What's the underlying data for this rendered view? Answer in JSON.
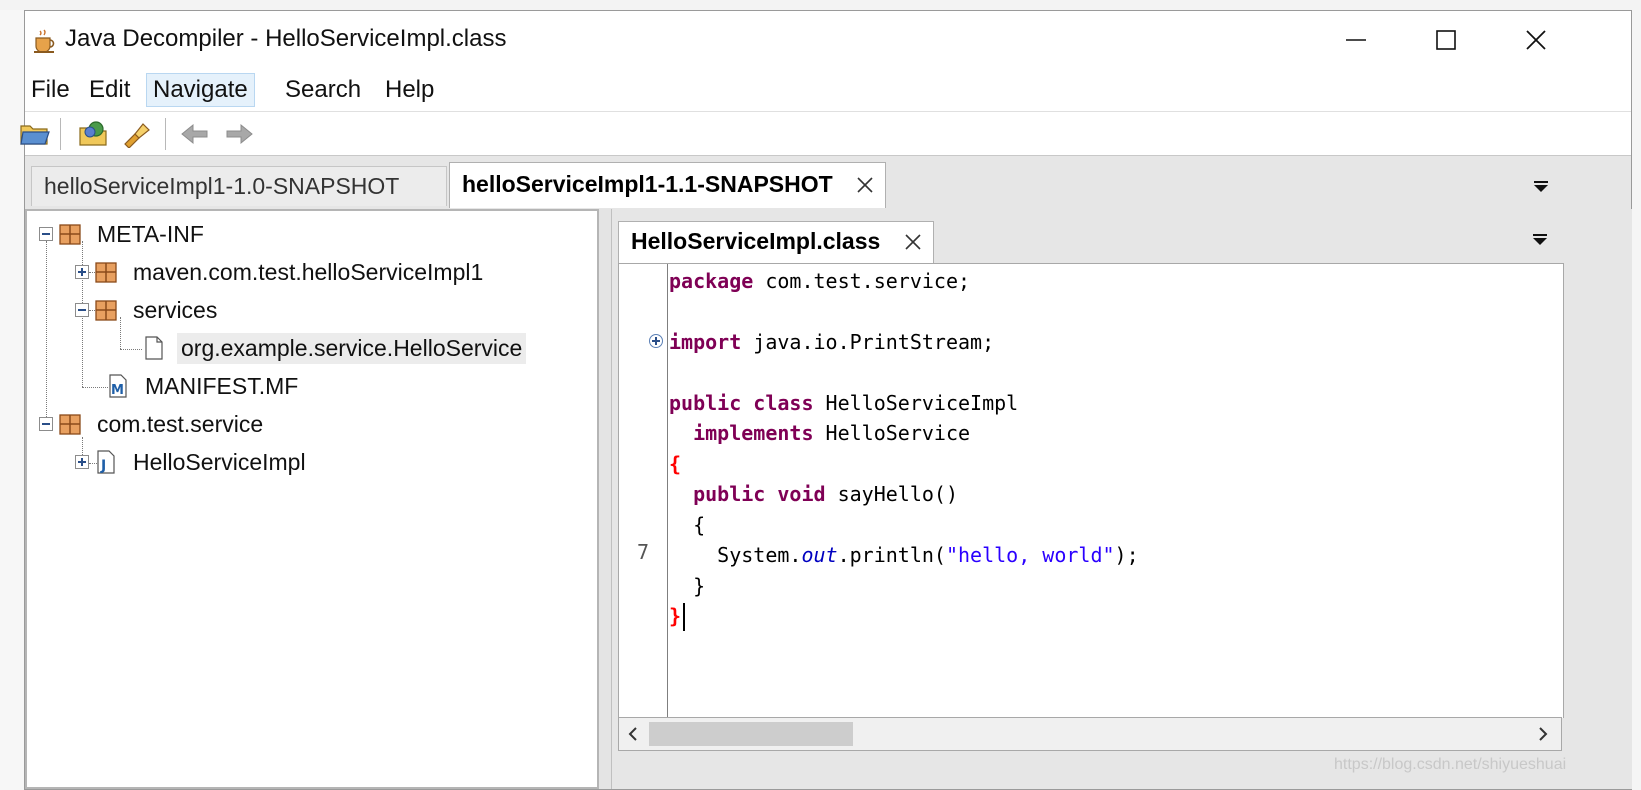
{
  "window": {
    "title": "Java Decompiler - HelloServiceImpl.class"
  },
  "menu": [
    {
      "key": "file",
      "label": "File"
    },
    {
      "key": "edit",
      "label": "Edit"
    },
    {
      "key": "navigate",
      "label": "Navigate"
    },
    {
      "key": "search",
      "label": "Search"
    },
    {
      "key": "help",
      "label": "Help"
    }
  ],
  "toolbar": {
    "icons": [
      "open-file-icon",
      "open-type-icon",
      "search-flashlight-icon",
      "back-arrow-icon",
      "forward-arrow-icon"
    ]
  },
  "main_tabs": [
    {
      "label": "helloServiceImpl1-1.0-SNAPSHOT",
      "active": false
    },
    {
      "label": "helloServiceImpl1-1.1-SNAPSHOT",
      "active": true
    }
  ],
  "tree": {
    "rows": [
      {
        "label": "META-INF",
        "icon": "package-icon"
      },
      {
        "label": "maven.com.test.helloServiceImpl1",
        "icon": "package-icon"
      },
      {
        "label": "services",
        "icon": "package-icon"
      },
      {
        "label": "org.example.service.HelloService",
        "icon": "file-icon",
        "selected": true
      },
      {
        "label": "MANIFEST.MF",
        "icon": "manifest-icon"
      },
      {
        "label": "com.test.service",
        "icon": "package-icon"
      },
      {
        "label": "HelloServiceImpl",
        "icon": "java-class-icon"
      }
    ]
  },
  "editor": {
    "tab_label": "HelloServiceImpl.class",
    "line_number": "7",
    "code": {
      "l1_kw": "package",
      "l1_rest": " com.test.service;",
      "l2_kw": "import",
      "l2_rest": " java.io.PrintStream;",
      "l3_kw1": "public",
      "l3_kw2": "class",
      "l3_rest": " HelloServiceImpl",
      "l4_kw": "implements",
      "l4_rest": " HelloService",
      "l5_brace": "{",
      "l6_kw1": "public",
      "l6_kw2": "void",
      "l6_rest": " sayHello()",
      "l7": "{",
      "l8_a": "System.",
      "l8_field": "out",
      "l8_b": ".println(",
      "l8_str": "\"hello, world\"",
      "l8_c": ");",
      "l9": "}",
      "l10_brace": "}"
    }
  },
  "watermark": "https://blog.csdn.net/shiyueshuai",
  "colors": {
    "keyword": "#7f0055",
    "string": "#2a00ff",
    "field": "#0000c0",
    "brace": "#ff0000"
  }
}
